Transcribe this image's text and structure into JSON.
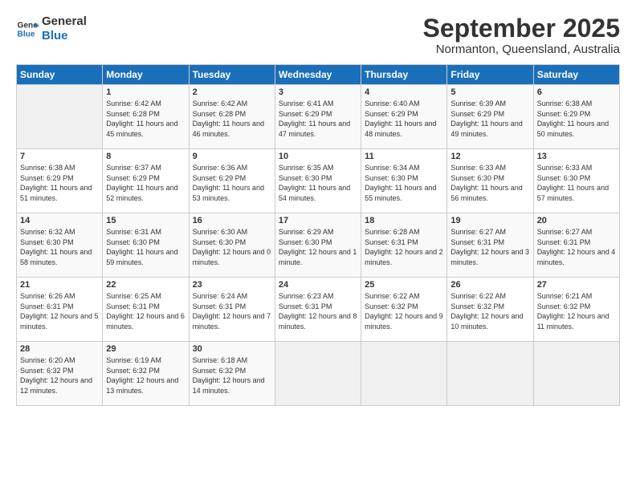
{
  "header": {
    "logo_line1": "General",
    "logo_line2": "Blue",
    "month": "September 2025",
    "location": "Normanton, Queensland, Australia"
  },
  "days_of_week": [
    "Sunday",
    "Monday",
    "Tuesday",
    "Wednesday",
    "Thursday",
    "Friday",
    "Saturday"
  ],
  "weeks": [
    [
      {
        "num": "",
        "sunrise": "",
        "sunset": "",
        "daylight": ""
      },
      {
        "num": "1",
        "sunrise": "Sunrise: 6:42 AM",
        "sunset": "Sunset: 6:28 PM",
        "daylight": "Daylight: 11 hours and 45 minutes."
      },
      {
        "num": "2",
        "sunrise": "Sunrise: 6:42 AM",
        "sunset": "Sunset: 6:28 PM",
        "daylight": "Daylight: 11 hours and 46 minutes."
      },
      {
        "num": "3",
        "sunrise": "Sunrise: 6:41 AM",
        "sunset": "Sunset: 6:29 PM",
        "daylight": "Daylight: 11 hours and 47 minutes."
      },
      {
        "num": "4",
        "sunrise": "Sunrise: 6:40 AM",
        "sunset": "Sunset: 6:29 PM",
        "daylight": "Daylight: 11 hours and 48 minutes."
      },
      {
        "num": "5",
        "sunrise": "Sunrise: 6:39 AM",
        "sunset": "Sunset: 6:29 PM",
        "daylight": "Daylight: 11 hours and 49 minutes."
      },
      {
        "num": "6",
        "sunrise": "Sunrise: 6:38 AM",
        "sunset": "Sunset: 6:29 PM",
        "daylight": "Daylight: 11 hours and 50 minutes."
      }
    ],
    [
      {
        "num": "7",
        "sunrise": "Sunrise: 6:38 AM",
        "sunset": "Sunset: 6:29 PM",
        "daylight": "Daylight: 11 hours and 51 minutes."
      },
      {
        "num": "8",
        "sunrise": "Sunrise: 6:37 AM",
        "sunset": "Sunset: 6:29 PM",
        "daylight": "Daylight: 11 hours and 52 minutes."
      },
      {
        "num": "9",
        "sunrise": "Sunrise: 6:36 AM",
        "sunset": "Sunset: 6:29 PM",
        "daylight": "Daylight: 11 hours and 53 minutes."
      },
      {
        "num": "10",
        "sunrise": "Sunrise: 6:35 AM",
        "sunset": "Sunset: 6:30 PM",
        "daylight": "Daylight: 11 hours and 54 minutes."
      },
      {
        "num": "11",
        "sunrise": "Sunrise: 6:34 AM",
        "sunset": "Sunset: 6:30 PM",
        "daylight": "Daylight: 11 hours and 55 minutes."
      },
      {
        "num": "12",
        "sunrise": "Sunrise: 6:33 AM",
        "sunset": "Sunset: 6:30 PM",
        "daylight": "Daylight: 11 hours and 56 minutes."
      },
      {
        "num": "13",
        "sunrise": "Sunrise: 6:33 AM",
        "sunset": "Sunset: 6:30 PM",
        "daylight": "Daylight: 11 hours and 57 minutes."
      }
    ],
    [
      {
        "num": "14",
        "sunrise": "Sunrise: 6:32 AM",
        "sunset": "Sunset: 6:30 PM",
        "daylight": "Daylight: 11 hours and 58 minutes."
      },
      {
        "num": "15",
        "sunrise": "Sunrise: 6:31 AM",
        "sunset": "Sunset: 6:30 PM",
        "daylight": "Daylight: 11 hours and 59 minutes."
      },
      {
        "num": "16",
        "sunrise": "Sunrise: 6:30 AM",
        "sunset": "Sunset: 6:30 PM",
        "daylight": "Daylight: 12 hours and 0 minutes."
      },
      {
        "num": "17",
        "sunrise": "Sunrise: 6:29 AM",
        "sunset": "Sunset: 6:30 PM",
        "daylight": "Daylight: 12 hours and 1 minute."
      },
      {
        "num": "18",
        "sunrise": "Sunrise: 6:28 AM",
        "sunset": "Sunset: 6:31 PM",
        "daylight": "Daylight: 12 hours and 2 minutes."
      },
      {
        "num": "19",
        "sunrise": "Sunrise: 6:27 AM",
        "sunset": "Sunset: 6:31 PM",
        "daylight": "Daylight: 12 hours and 3 minutes."
      },
      {
        "num": "20",
        "sunrise": "Sunrise: 6:27 AM",
        "sunset": "Sunset: 6:31 PM",
        "daylight": "Daylight: 12 hours and 4 minutes."
      }
    ],
    [
      {
        "num": "21",
        "sunrise": "Sunrise: 6:26 AM",
        "sunset": "Sunset: 6:31 PM",
        "daylight": "Daylight: 12 hours and 5 minutes."
      },
      {
        "num": "22",
        "sunrise": "Sunrise: 6:25 AM",
        "sunset": "Sunset: 6:31 PM",
        "daylight": "Daylight: 12 hours and 6 minutes."
      },
      {
        "num": "23",
        "sunrise": "Sunrise: 6:24 AM",
        "sunset": "Sunset: 6:31 PM",
        "daylight": "Daylight: 12 hours and 7 minutes."
      },
      {
        "num": "24",
        "sunrise": "Sunrise: 6:23 AM",
        "sunset": "Sunset: 6:31 PM",
        "daylight": "Daylight: 12 hours and 8 minutes."
      },
      {
        "num": "25",
        "sunrise": "Sunrise: 6:22 AM",
        "sunset": "Sunset: 6:32 PM",
        "daylight": "Daylight: 12 hours and 9 minutes."
      },
      {
        "num": "26",
        "sunrise": "Sunrise: 6:22 AM",
        "sunset": "Sunset: 6:32 PM",
        "daylight": "Daylight: 12 hours and 10 minutes."
      },
      {
        "num": "27",
        "sunrise": "Sunrise: 6:21 AM",
        "sunset": "Sunset: 6:32 PM",
        "daylight": "Daylight: 12 hours and 11 minutes."
      }
    ],
    [
      {
        "num": "28",
        "sunrise": "Sunrise: 6:20 AM",
        "sunset": "Sunset: 6:32 PM",
        "daylight": "Daylight: 12 hours and 12 minutes."
      },
      {
        "num": "29",
        "sunrise": "Sunrise: 6:19 AM",
        "sunset": "Sunset: 6:32 PM",
        "daylight": "Daylight: 12 hours and 13 minutes."
      },
      {
        "num": "30",
        "sunrise": "Sunrise: 6:18 AM",
        "sunset": "Sunset: 6:32 PM",
        "daylight": "Daylight: 12 hours and 14 minutes."
      },
      {
        "num": "",
        "sunrise": "",
        "sunset": "",
        "daylight": ""
      },
      {
        "num": "",
        "sunrise": "",
        "sunset": "",
        "daylight": ""
      },
      {
        "num": "",
        "sunrise": "",
        "sunset": "",
        "daylight": ""
      },
      {
        "num": "",
        "sunrise": "",
        "sunset": "",
        "daylight": ""
      }
    ]
  ]
}
